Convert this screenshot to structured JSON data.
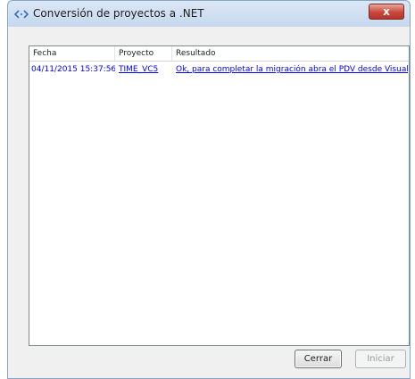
{
  "window": {
    "title": "Conversión de proyectos a .NET",
    "close_label": "x",
    "title_icon": "code-brackets-icon"
  },
  "list": {
    "columns": [
      "Fecha",
      "Proyecto",
      "Resultado"
    ],
    "rows": [
      {
        "fecha": "04/11/2015 15:37:56",
        "proyecto": "TIME_VC5",
        "resultado": "Ok, para completar la migración abra el PDV desde Visual Ch..."
      }
    ]
  },
  "buttons": {
    "cerrar": "Cerrar",
    "iniciar": "Iniciar"
  },
  "colors": {
    "row_text": "#0000ff",
    "disabled_text": "#9a9a9a"
  }
}
